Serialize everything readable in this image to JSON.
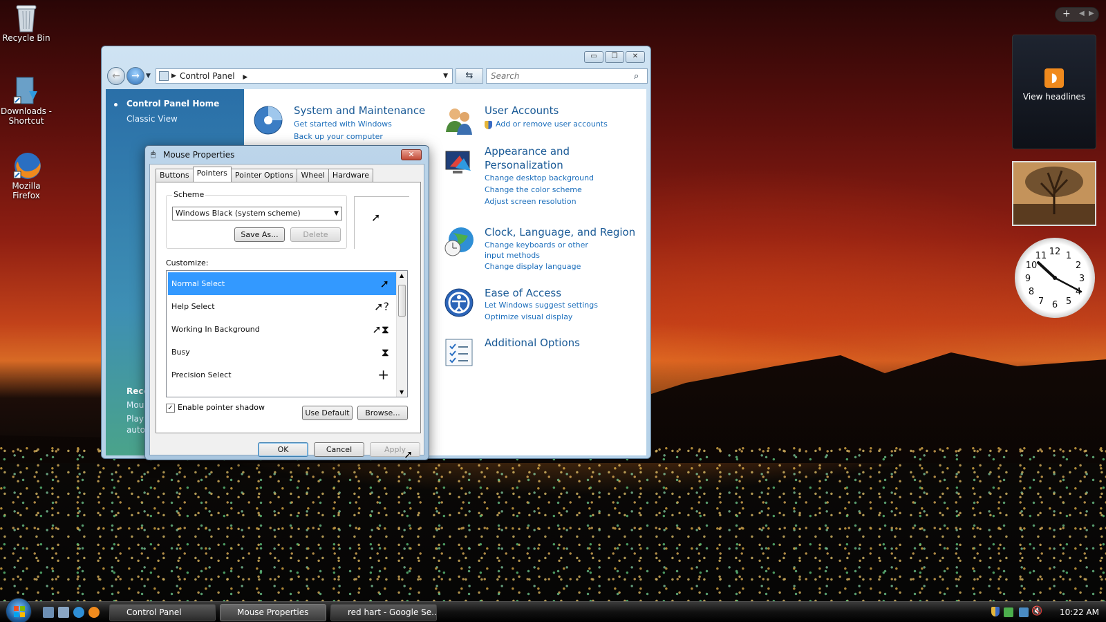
{
  "desktop": {
    "icons": [
      {
        "label": "Recycle Bin"
      },
      {
        "label": "Downloads - Shortcut"
      },
      {
        "label": "Mozilla Firefox"
      }
    ]
  },
  "gadgets": {
    "rss_label": "View headlines",
    "clock_numbers": [
      "12",
      "1",
      "2",
      "3",
      "4",
      "5",
      "6",
      "7",
      "8",
      "9",
      "10",
      "11"
    ]
  },
  "control_panel": {
    "breadcrumb": "Control Panel",
    "search_placeholder": "Search",
    "left_nav": {
      "home": "Control Panel Home",
      "classic": "Classic View",
      "recent_heading": "Rece",
      "recent_items": [
        "Mou",
        "Play",
        "auto"
      ]
    },
    "categories": [
      {
        "title": "System and Maintenance",
        "links": [
          "Get started with Windows",
          "Back up your computer"
        ]
      },
      {
        "title": "User Accounts",
        "links": [
          "Add or remove user accounts"
        ]
      },
      {
        "title": "Appearance and Personalization",
        "links": [
          "Change desktop background",
          "Change the color scheme",
          "Adjust screen resolution"
        ]
      },
      {
        "title": "Clock, Language, and Region",
        "links": [
          "Change keyboards or other input methods",
          "Change display language"
        ]
      },
      {
        "title": "Ease of Access",
        "links": [
          "Let Windows suggest settings",
          "Optimize visual display"
        ]
      },
      {
        "title": "Additional Options",
        "links": []
      }
    ],
    "window_buttons": {
      "minimize": "▭",
      "maximize": "❐",
      "close": "✕"
    }
  },
  "mouse_properties": {
    "title": "Mouse Properties",
    "tabs": [
      "Buttons",
      "Pointers",
      "Pointer Options",
      "Wheel",
      "Hardware"
    ],
    "active_tab": "Pointers",
    "scheme_label": "Scheme",
    "scheme_value": "Windows Black (system scheme)",
    "save_as": "Save As...",
    "delete": "Delete",
    "customize_label": "Customize:",
    "pointers": [
      {
        "name": "Normal Select",
        "cursor": "➚",
        "selected": true
      },
      {
        "name": "Help Select",
        "cursor": "➚?"
      },
      {
        "name": "Working In Background",
        "cursor": "➚⧗"
      },
      {
        "name": "Busy",
        "cursor": "⧗"
      },
      {
        "name": "Precision Select",
        "cursor": "+"
      }
    ],
    "enable_shadow_label": "Enable pointer shadow",
    "enable_shadow_checked": true,
    "use_default": "Use Default",
    "browse": "Browse...",
    "ok": "OK",
    "cancel": "Cancel",
    "apply": "Apply"
  },
  "taskbar": {
    "buttons": [
      {
        "label": "Control Panel"
      },
      {
        "label": "Mouse Properties"
      },
      {
        "label": "red hart - Google Se..."
      }
    ],
    "time": "10:22 AM"
  }
}
